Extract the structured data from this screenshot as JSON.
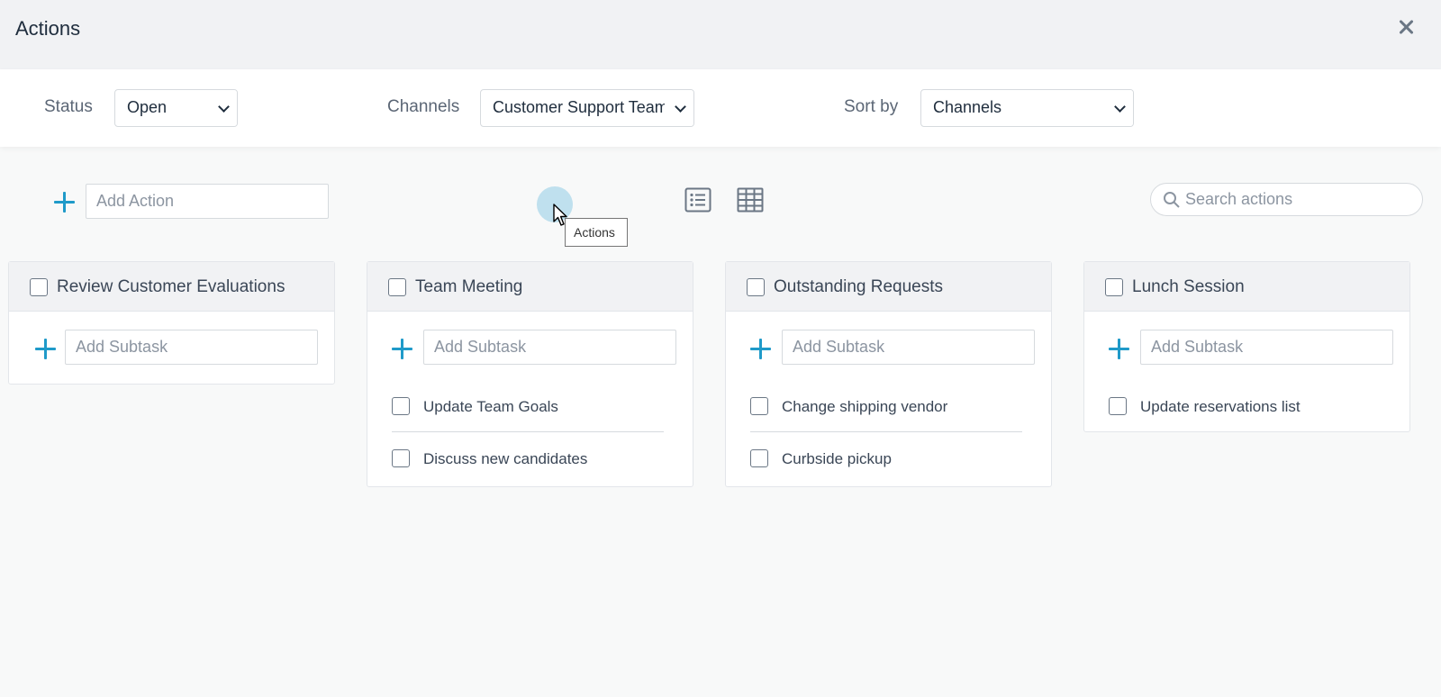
{
  "window": {
    "title": "Actions"
  },
  "filters": {
    "status": {
      "label": "Status",
      "value": "Open"
    },
    "channels": {
      "label": "Channels",
      "value": "Customer Support Team"
    },
    "sort": {
      "label": "Sort by",
      "value": "Channels"
    }
  },
  "toolbar": {
    "add_action_placeholder": "Add Action",
    "search_placeholder": "Search actions",
    "tooltip": "Actions"
  },
  "cards": [
    {
      "title": "Review Customer Evaluations",
      "subtask_placeholder": "Add Subtask",
      "subtasks": []
    },
    {
      "title": "Team Meeting",
      "subtask_placeholder": "Add Subtask",
      "subtasks": [
        "Update Team Goals",
        "Discuss new candidates"
      ]
    },
    {
      "title": "Outstanding Requests",
      "subtask_placeholder": "Add Subtask",
      "subtasks": [
        "Change shipping vendor",
        "Curbside pickup"
      ]
    },
    {
      "title": "Lunch Session",
      "subtask_placeholder": "Add Subtask",
      "subtasks": [
        "Update reservations list"
      ]
    }
  ],
  "colors": {
    "accent": "#1f9ac9",
    "header_bg": "#f1f2f4",
    "page_bg": "#f8f9f9"
  },
  "icons": [
    "close-icon",
    "plus-icon",
    "list-view-icon",
    "grid-view-icon",
    "search-icon",
    "cursor-icon"
  ]
}
